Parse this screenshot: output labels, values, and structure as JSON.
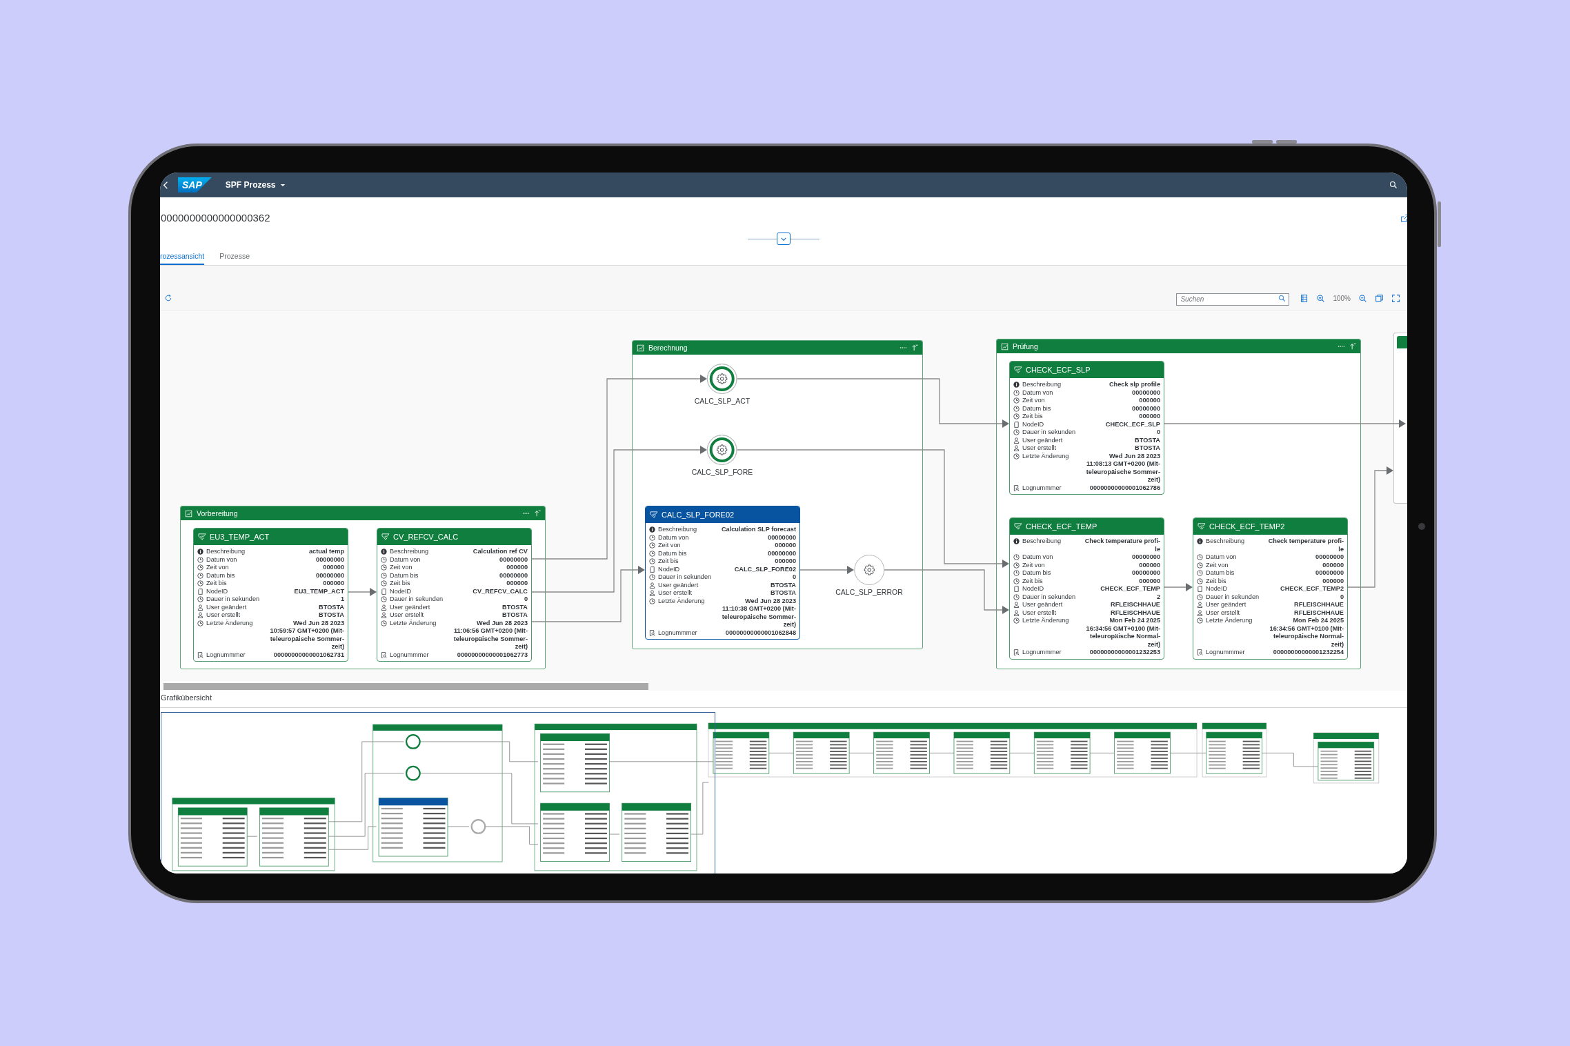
{
  "shell": {
    "logo": "SAP",
    "title": "SPF Prozess"
  },
  "header": {
    "title": "0000000000000000362",
    "tabs": [
      {
        "label": "rozessansicht",
        "selected": true
      },
      {
        "label": "Prozesse",
        "selected": false
      }
    ]
  },
  "toolbar": {
    "search": {
      "placeholder": "Suchen"
    },
    "zoom": "100%"
  },
  "lanes": [
    {
      "title": "Vorbereitung",
      "nodes": [
        {
          "kind": "card",
          "title": "EU3_TEMP_ACT",
          "selected": false,
          "rows": [
            {
              "kind": "info",
              "label": "Beschreibung",
              "value": [
                "actual temp"
              ]
            },
            {
              "kind": "clock",
              "label": "Datum von",
              "value": [
                "00000000"
              ]
            },
            {
              "kind": "clock",
              "label": "Zeit von",
              "value": [
                "000000"
              ]
            },
            {
              "kind": "clock",
              "label": "Datum bis",
              "value": [
                "00000000"
              ]
            },
            {
              "kind": "clock",
              "label": "Zeit bis",
              "value": [
                "000000"
              ]
            },
            {
              "kind": "doc",
              "label": "NodeID",
              "value": [
                "EU3_TEMP_ACT"
              ]
            },
            {
              "kind": "clock",
              "label": "Dauer in sekunden",
              "value": [
                "1"
              ]
            },
            {
              "kind": "user",
              "label": "User geändert",
              "value": [
                "BTOSTA"
              ]
            },
            {
              "kind": "user",
              "label": "User erstellt",
              "value": [
                "BTOSTA"
              ]
            },
            {
              "kind": "clock",
              "label": "Letzte Änderung",
              "value": [
                "Wed Jun 28 2023",
                "10:59:57 GMT+0200 (Mit-",
                "teleuropäische Sommer-",
                "zeit)"
              ]
            },
            {
              "kind": "log",
              "label": "Lognummmer",
              "value": [
                "00000000000001062731"
              ]
            }
          ]
        },
        {
          "kind": "card",
          "title": "CV_REFCV_CALC",
          "selected": false,
          "rows": [
            {
              "kind": "info",
              "label": "Beschreibung",
              "value": [
                "Calculation ref CV"
              ]
            },
            {
              "kind": "clock",
              "label": "Datum von",
              "value": [
                "00000000"
              ]
            },
            {
              "kind": "clock",
              "label": "Zeit von",
              "value": [
                "000000"
              ]
            },
            {
              "kind": "clock",
              "label": "Datum bis",
              "value": [
                "00000000"
              ]
            },
            {
              "kind": "clock",
              "label": "Zeit bis",
              "value": [
                "000000"
              ]
            },
            {
              "kind": "doc",
              "label": "NodeID",
              "value": [
                "CV_REFCV_CALC"
              ]
            },
            {
              "kind": "clock",
              "label": "Dauer in sekunden",
              "value": [
                "0"
              ]
            },
            {
              "kind": "user",
              "label": "User geändert",
              "value": [
                "BTOSTA"
              ]
            },
            {
              "kind": "user",
              "label": "User erstellt",
              "value": [
                "BTOSTA"
              ]
            },
            {
              "kind": "clock",
              "label": "Letzte Änderung",
              "value": [
                "Wed Jun 28 2023",
                "11:06:56 GMT+0200 (Mit-",
                "teleuropäische Sommer-",
                "zeit)"
              ]
            },
            {
              "kind": "log",
              "label": "Lognummmer",
              "value": [
                "00000000000001062773"
              ]
            }
          ]
        }
      ]
    },
    {
      "title": "Berechnung",
      "nodes": [
        {
          "kind": "step",
          "label": "CALC_SLP_ACT",
          "done": true
        },
        {
          "kind": "step",
          "label": "CALC_SLP_FORE",
          "done": true
        },
        {
          "kind": "card",
          "title": "CALC_SLP_FORE02",
          "selected": true,
          "rows": [
            {
              "kind": "info",
              "label": "Beschreibung",
              "value": [
                "Calculation SLP forecast"
              ]
            },
            {
              "kind": "clock",
              "label": "Datum von",
              "value": [
                "00000000"
              ]
            },
            {
              "kind": "clock",
              "label": "Zeit von",
              "value": [
                "000000"
              ]
            },
            {
              "kind": "clock",
              "label": "Datum bis",
              "value": [
                "00000000"
              ]
            },
            {
              "kind": "clock",
              "label": "Zeit bis",
              "value": [
                "000000"
              ]
            },
            {
              "kind": "doc",
              "label": "NodeID",
              "value": [
                "CALC_SLP_FORE02"
              ]
            },
            {
              "kind": "clock",
              "label": "Dauer in sekunden",
              "value": [
                "0"
              ]
            },
            {
              "kind": "user",
              "label": "User geändert",
              "value": [
                "BTOSTA"
              ]
            },
            {
              "kind": "user",
              "label": "User erstellt",
              "value": [
                "BTOSTA"
              ]
            },
            {
              "kind": "clock",
              "label": "Letzte Änderung",
              "value": [
                "Wed Jun 28 2023",
                "11:10:38 GMT+0200 (Mit-",
                "teleuropäische Sommer-",
                "zeit)"
              ]
            },
            {
              "kind": "log",
              "label": "Lognummmer",
              "value": [
                "00000000000001062848"
              ]
            }
          ]
        },
        {
          "kind": "step",
          "label": "CALC_SLP_ERROR",
          "done": false
        }
      ]
    },
    {
      "title": "Prüfung",
      "nodes": [
        {
          "kind": "card",
          "title": "CHECK_ECF_SLP",
          "selected": false,
          "rows": [
            {
              "kind": "info",
              "label": "Beschreibung",
              "value": [
                "Check slp profile"
              ]
            },
            {
              "kind": "clock",
              "label": "Datum von",
              "value": [
                "00000000"
              ]
            },
            {
              "kind": "clock",
              "label": "Zeit von",
              "value": [
                "000000"
              ]
            },
            {
              "kind": "clock",
              "label": "Datum bis",
              "value": [
                "00000000"
              ]
            },
            {
              "kind": "clock",
              "label": "Zeit bis",
              "value": [
                "000000"
              ]
            },
            {
              "kind": "doc",
              "label": "NodeID",
              "value": [
                "CHECK_ECF_SLP"
              ]
            },
            {
              "kind": "clock",
              "label": "Dauer in sekunden",
              "value": [
                "0"
              ]
            },
            {
              "kind": "user",
              "label": "User geändert",
              "value": [
                "BTOSTA"
              ]
            },
            {
              "kind": "user",
              "label": "User erstellt",
              "value": [
                "BTOSTA"
              ]
            },
            {
              "kind": "clock",
              "label": "Letzte Änderung",
              "value": [
                "Wed Jun 28 2023",
                "11:08:13 GMT+0200 (Mit-",
                "teleuropäische Sommer-",
                "zeit)"
              ]
            },
            {
              "kind": "log",
              "label": "Lognummmer",
              "value": [
                "00000000000001062786"
              ]
            }
          ]
        },
        {
          "kind": "card",
          "title": "CHECK_ECF_TEMP",
          "selected": false,
          "rows": [
            {
              "kind": "info",
              "label": "Beschreibung",
              "value": [
                "Check temperature profi-",
                "le"
              ]
            },
            {
              "kind": "clock",
              "label": "Datum von",
              "value": [
                "00000000"
              ]
            },
            {
              "kind": "clock",
              "label": "Zeit von",
              "value": [
                "000000"
              ]
            },
            {
              "kind": "clock",
              "label": "Datum bis",
              "value": [
                "00000000"
              ]
            },
            {
              "kind": "clock",
              "label": "Zeit bis",
              "value": [
                "000000"
              ]
            },
            {
              "kind": "doc",
              "label": "NodeID",
              "value": [
                "CHECK_ECF_TEMP"
              ]
            },
            {
              "kind": "clock",
              "label": "Dauer in sekunden",
              "value": [
                "2"
              ]
            },
            {
              "kind": "user",
              "label": "User geändert",
              "value": [
                "RFLEISCHHAUE"
              ]
            },
            {
              "kind": "user",
              "label": "User erstellt",
              "value": [
                "RFLEISCHHAUE"
              ]
            },
            {
              "kind": "clock",
              "label": "Letzte Änderung",
              "value": [
                "Mon Feb 24 2025",
                "16:34:56 GMT+0100 (Mit-",
                "teleuropäische Normal-",
                "zeit)"
              ]
            },
            {
              "kind": "log",
              "label": "Lognummmer",
              "value": [
                "00000000000001232253"
              ]
            }
          ]
        },
        {
          "kind": "card",
          "title": "CHECK_ECF_TEMP2",
          "selected": false,
          "rows": [
            {
              "kind": "info",
              "label": "Beschreibung",
              "value": [
                "Check temperature profi-",
                "le"
              ]
            },
            {
              "kind": "clock",
              "label": "Datum von",
              "value": [
                "00000000"
              ]
            },
            {
              "kind": "clock",
              "label": "Zeit von",
              "value": [
                "000000"
              ]
            },
            {
              "kind": "clock",
              "label": "Datum bis",
              "value": [
                "00000000"
              ]
            },
            {
              "kind": "clock",
              "label": "Zeit bis",
              "value": [
                "000000"
              ]
            },
            {
              "kind": "doc",
              "label": "NodeID",
              "value": [
                "CHECK_ECF_TEMP2"
              ]
            },
            {
              "kind": "clock",
              "label": "Dauer in sekunden",
              "value": [
                "0"
              ]
            },
            {
              "kind": "user",
              "label": "User geändert",
              "value": [
                "RFLEISCHHAUE"
              ]
            },
            {
              "kind": "user",
              "label": "User erstellt",
              "value": [
                "RFLEISCHHAUE"
              ]
            },
            {
              "kind": "clock",
              "label": "Letzte Änderung",
              "value": [
                "Mon Feb 24 2025",
                "16:34:56 GMT+0100 (Mit-",
                "teleuropäische Normal-",
                "zeit)"
              ]
            },
            {
              "kind": "log",
              "label": "Lognummmer",
              "value": [
                "00000000000001232254"
              ]
            }
          ]
        }
      ]
    }
  ],
  "overview": {
    "title": "Grafikübersicht"
  }
}
